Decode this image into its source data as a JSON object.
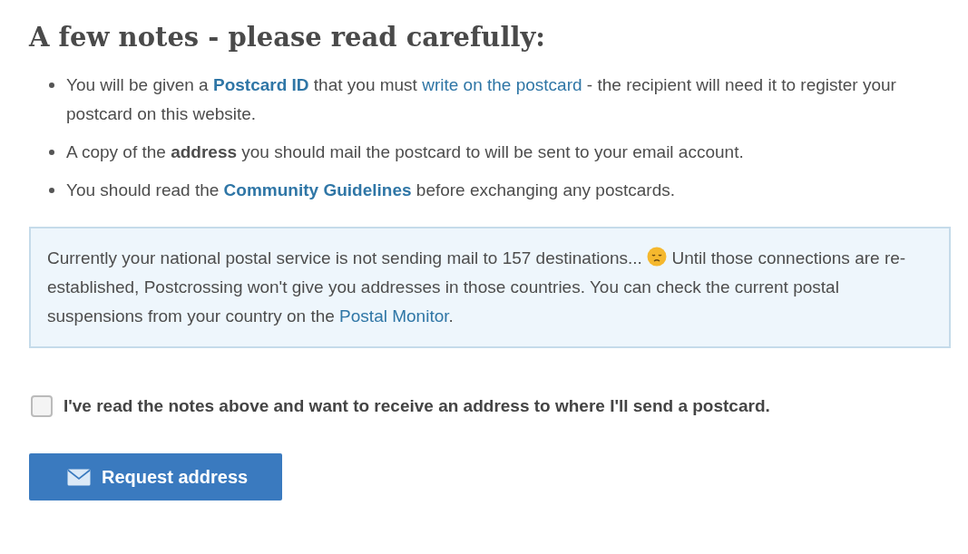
{
  "heading": "A few notes - please read carefully:",
  "notes": [
    {
      "parts": [
        {
          "kind": "text",
          "text": "You will be given a "
        },
        {
          "kind": "bold_link",
          "text": "Postcard ID"
        },
        {
          "kind": "text",
          "text": " that you must "
        },
        {
          "kind": "link",
          "text": "write on the postcard"
        },
        {
          "kind": "text",
          "text": " - the recipient will need it to register your postcard on this website."
        }
      ]
    },
    {
      "parts": [
        {
          "kind": "text",
          "text": "A copy of the "
        },
        {
          "kind": "bold",
          "text": "address"
        },
        {
          "kind": "text",
          "text": " you should mail the postcard to will be sent to your email account."
        }
      ]
    },
    {
      "parts": [
        {
          "kind": "text",
          "text": "You should read the "
        },
        {
          "kind": "bold_link",
          "text": "Community Guidelines"
        },
        {
          "kind": "text",
          "text": " before exchanging any postcards."
        }
      ]
    }
  ],
  "notice": {
    "parts": [
      {
        "kind": "text",
        "text": "Currently your national postal service is not sending mail to 157 destinations... "
      },
      {
        "kind": "emoji"
      },
      {
        "kind": "text",
        "text": " Until those connections are re-established, Postcrossing won't give you addresses in those countries. You can check the current postal suspensions from your country on the "
      },
      {
        "kind": "link",
        "text": "Postal Monitor"
      },
      {
        "kind": "text",
        "text": "."
      }
    ]
  },
  "agreement": {
    "label": "I've read the notes above and want to receive an address to where I'll send a postcard.",
    "checked": false
  },
  "button": {
    "label": "Request address"
  }
}
